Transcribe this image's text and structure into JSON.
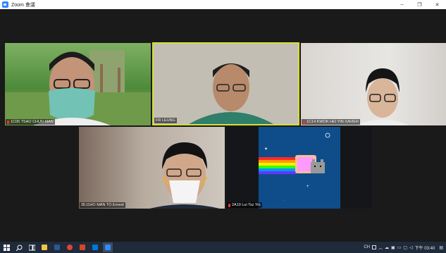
{
  "window": {
    "title": "Zoom 會議",
    "controls": {
      "minimize": "–",
      "restore": "❐",
      "close": "✕"
    }
  },
  "participants": [
    {
      "id": "p1",
      "name": "1C05 TSAO CHUN MAN",
      "muted": true
    },
    {
      "id": "p2",
      "name": "FR LEUNG",
      "muted": false,
      "active_speaker": true
    },
    {
      "id": "p3",
      "name": "1C14 KWOK HEI YIN XAVIER",
      "muted": true
    },
    {
      "id": "p4",
      "name": "2E11HO MAN TO Ernest",
      "muted": false
    },
    {
      "id": "p5",
      "name": "2A19 Lui Tsz Yin",
      "muted": true
    }
  ],
  "taskbar": {
    "start_icon": "windows-start-icon",
    "search_icon": "search-icon",
    "taskview_icon": "task-view-icon",
    "apps": [
      "file-explorer-icon",
      "word-icon",
      "chrome-icon",
      "powerpoint-icon",
      "photos-icon",
      "zoom-icon"
    ],
    "tray": {
      "lang": "CH",
      "clock": "下午 03:40"
    }
  },
  "colors": {
    "active_speaker_border": "#d6df38",
    "mic_muted": "#e33333",
    "zoom_blue": "#2d8cff"
  }
}
